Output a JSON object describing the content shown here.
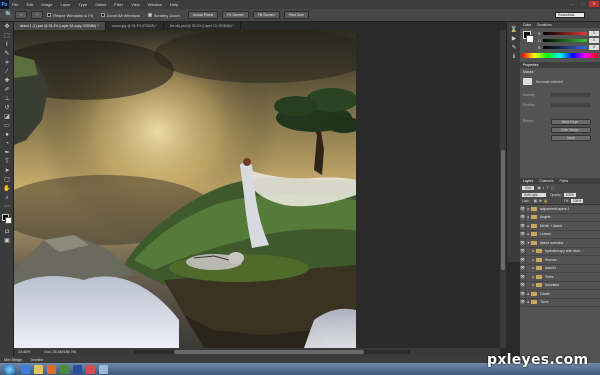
{
  "menubar": {
    "logo": "Ps",
    "items": [
      "File",
      "Edit",
      "Image",
      "Layer",
      "Type",
      "Select",
      "Filter",
      "View",
      "Window",
      "Help"
    ]
  },
  "options": {
    "checks": [
      "Resize Windows to Fit",
      "Zoom All Windows",
      "Scrubby Zoom"
    ],
    "buttons": [
      "Actual Pixels",
      "Fit Screen",
      "Fill Screen",
      "Print Size"
    ],
    "workspace": "Essentials"
  },
  "tabs": [
    {
      "label": "island 1 (1).psd @ 33.4% (Layer 63 copy, RGB/8#) *",
      "active": true
    },
    {
      "label": "ocean.jpg @ 33.3% (RGB/8) *",
      "active": false
    },
    {
      "label": "fire obj.psd @ 33.3% (Layer 10, RGB/8#) *",
      "active": false
    }
  ],
  "status": {
    "zoom": "33.48%",
    "doc": "Doc: 26.4M/186.7M"
  },
  "minibridge": {
    "tabs": [
      "Mini Bridge",
      "Timeline"
    ]
  },
  "color_panel": {
    "tabs": [
      "Color",
      "Swatches"
    ],
    "rows": [
      {
        "label": "R",
        "value": "0"
      },
      {
        "label": "G",
        "value": "0"
      },
      {
        "label": "B",
        "value": "0"
      }
    ],
    "colors": {
      "red": "#e23a3a",
      "green": "#3ac43a",
      "blue": "#3a6ae2"
    }
  },
  "properties": {
    "tab": "Properties",
    "section": "Masks",
    "mask_label": "No mask selected",
    "fields": [
      "Density:",
      "Feather:"
    ],
    "refine_label": "Refine:",
    "buttons": [
      "Mask Edge...",
      "Color Range...",
      "Invert"
    ]
  },
  "layers_panel": {
    "tabs": [
      "Layers",
      "Channels",
      "Paths"
    ],
    "kind": "Kind",
    "blend": "Soft Light",
    "opacity_label": "Opacity:",
    "opacity": "100%",
    "lock_label": "Lock:",
    "fill_label": "Fill:",
    "fill": "100%",
    "rows": [
      {
        "name": "adjustment layers 1",
        "folder": true,
        "indent": 0
      },
      {
        "name": "Angels",
        "folder": true,
        "indent": 0
      },
      {
        "name": "Merlin + island",
        "folder": true,
        "indent": 0
      },
      {
        "name": "Leaves",
        "folder": true,
        "indent": 0
      },
      {
        "name": "Island overview",
        "folder": true,
        "indent": 0
      },
      {
        "name": "hydrotherapy side islan...",
        "folder": true,
        "indent": 1
      },
      {
        "name": "Woman",
        "folder": true,
        "indent": 1
      },
      {
        "name": "Island3",
        "folder": true,
        "indent": 1
      },
      {
        "name": "Trees",
        "folder": true,
        "indent": 1
      },
      {
        "name": "Mountain",
        "folder": true,
        "indent": 1
      },
      {
        "name": "Castle",
        "folder": true,
        "indent": 0
      },
      {
        "name": "Trees",
        "folder": true,
        "indent": 0
      }
    ]
  },
  "watermark": "pxleyes.com"
}
